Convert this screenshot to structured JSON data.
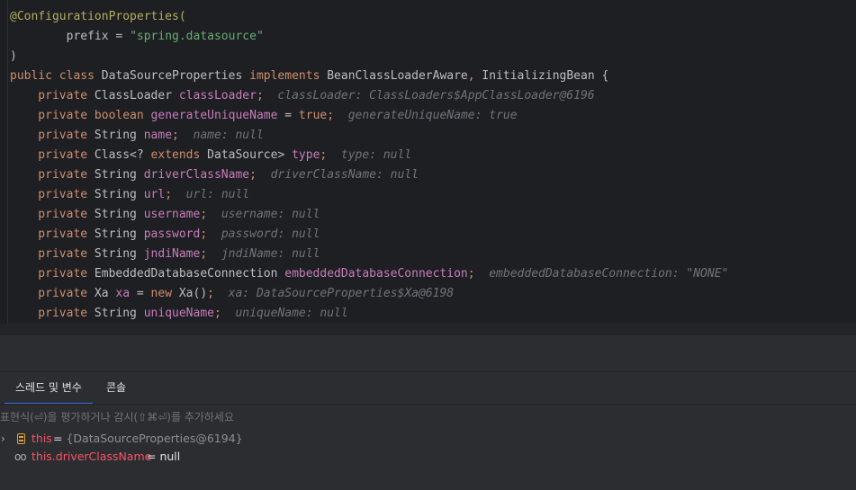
{
  "editor": {
    "lines": [
      [
        {
          "t": "@ConfigurationProperties(",
          "c": "ann"
        }
      ],
      [
        {
          "t": "        prefix = ",
          "c": "plain"
        },
        {
          "t": "\"spring.datasource\"",
          "c": "str"
        }
      ],
      [
        {
          "t": ")",
          "c": "plain"
        }
      ],
      [
        {
          "t": "public class ",
          "c": "kw"
        },
        {
          "t": "DataSourceProperties ",
          "c": "plain"
        },
        {
          "t": "implements ",
          "c": "kw"
        },
        {
          "t": "BeanClassLoaderAware",
          "c": "plain"
        },
        {
          "t": ", ",
          "c": "kw"
        },
        {
          "t": "InitializingBean {",
          "c": "plain"
        }
      ],
      [
        {
          "t": "    private ",
          "c": "kw"
        },
        {
          "t": "ClassLoader ",
          "c": "plain"
        },
        {
          "t": "classLoader",
          "c": "fld"
        },
        {
          "t": ";",
          "c": "kw"
        },
        {
          "t": "  classLoader: ClassLoaders$AppClassLoader@6196",
          "c": "hint"
        }
      ],
      [
        {
          "t": "    private ",
          "c": "kw"
        },
        {
          "t": "boolean ",
          "c": "kw"
        },
        {
          "t": "generateUniqueName",
          "c": "fld"
        },
        {
          "t": " = ",
          "c": "plain"
        },
        {
          "t": "true",
          "c": "kw"
        },
        {
          "t": ";",
          "c": "kw"
        },
        {
          "t": "  generateUniqueName: true",
          "c": "hint"
        }
      ],
      [
        {
          "t": "    private ",
          "c": "kw"
        },
        {
          "t": "String ",
          "c": "plain"
        },
        {
          "t": "name",
          "c": "fld"
        },
        {
          "t": ";",
          "c": "kw"
        },
        {
          "t": "  name: null",
          "c": "hint"
        }
      ],
      [
        {
          "t": "    private ",
          "c": "kw"
        },
        {
          "t": "Class<? ",
          "c": "plain"
        },
        {
          "t": "extends ",
          "c": "kw"
        },
        {
          "t": "DataSource> ",
          "c": "plain"
        },
        {
          "t": "type",
          "c": "fld"
        },
        {
          "t": ";",
          "c": "kw"
        },
        {
          "t": "  type: null",
          "c": "hint"
        }
      ],
      [
        {
          "t": "    private ",
          "c": "kw"
        },
        {
          "t": "String ",
          "c": "plain"
        },
        {
          "t": "driverClassName",
          "c": "fld"
        },
        {
          "t": ";",
          "c": "kw"
        },
        {
          "t": "  driverClassName: null",
          "c": "hint"
        }
      ],
      [
        {
          "t": "    private ",
          "c": "kw"
        },
        {
          "t": "String ",
          "c": "plain"
        },
        {
          "t": "url",
          "c": "fld"
        },
        {
          "t": ";",
          "c": "kw"
        },
        {
          "t": "  url: null",
          "c": "hint"
        }
      ],
      [
        {
          "t": "    private ",
          "c": "kw"
        },
        {
          "t": "String ",
          "c": "plain"
        },
        {
          "t": "username",
          "c": "fld"
        },
        {
          "t": ";",
          "c": "kw"
        },
        {
          "t": "  username: null",
          "c": "hint"
        }
      ],
      [
        {
          "t": "    private ",
          "c": "kw"
        },
        {
          "t": "String ",
          "c": "plain"
        },
        {
          "t": "password",
          "c": "fld"
        },
        {
          "t": ";",
          "c": "kw"
        },
        {
          "t": "  password: null",
          "c": "hint"
        }
      ],
      [
        {
          "t": "    private ",
          "c": "kw"
        },
        {
          "t": "String ",
          "c": "plain"
        },
        {
          "t": "jndiName",
          "c": "fld"
        },
        {
          "t": ";",
          "c": "kw"
        },
        {
          "t": "  jndiName: null",
          "c": "hint"
        }
      ],
      [
        {
          "t": "    private ",
          "c": "kw"
        },
        {
          "t": "EmbeddedDatabaseConnection ",
          "c": "plain"
        },
        {
          "t": "embeddedDatabaseConnection",
          "c": "fld"
        },
        {
          "t": ";",
          "c": "kw"
        },
        {
          "t": "  embeddedDatabaseConnection: \"NONE\"",
          "c": "hint"
        }
      ],
      [
        {
          "t": "    private ",
          "c": "kw"
        },
        {
          "t": "Xa ",
          "c": "plain"
        },
        {
          "t": "xa",
          "c": "fld"
        },
        {
          "t": " = ",
          "c": "plain"
        },
        {
          "t": "new ",
          "c": "kw"
        },
        {
          "t": "Xa()",
          "c": "plain"
        },
        {
          "t": ";",
          "c": "kw"
        },
        {
          "t": "  xa: DataSourceProperties$Xa@6198",
          "c": "hint"
        }
      ],
      [
        {
          "t": "    private ",
          "c": "kw"
        },
        {
          "t": "String ",
          "c": "plain"
        },
        {
          "t": "uniqueName",
          "c": "fld"
        },
        {
          "t": ";",
          "c": "kw"
        },
        {
          "t": "  uniqueName: null",
          "c": "hint"
        }
      ]
    ]
  },
  "debug": {
    "tabs": [
      {
        "label": "스레드 및 변수",
        "active": true
      },
      {
        "label": "콘솔",
        "active": false
      }
    ],
    "eval_placeholder": "표현식(⏎)을 평가하거나 감시(⇧⌘⏎)를 추가하세요",
    "variables": [
      {
        "name": "this",
        "eq": " = ",
        "value": "{DataSourceProperties@6194}",
        "expandable": true,
        "icon": "field-icon"
      },
      {
        "name": "this.driverClassName",
        "eq": " = ",
        "value": "null",
        "expandable": false,
        "icon": "watch-icon"
      }
    ]
  },
  "colors": {
    "keyword": "#cf8e6d",
    "annotation": "#b3ae60",
    "string": "#6aab73",
    "field": "#c77dbb",
    "hint": "#6f737a",
    "accent": "#3574f0",
    "var_name": "#f75464"
  }
}
